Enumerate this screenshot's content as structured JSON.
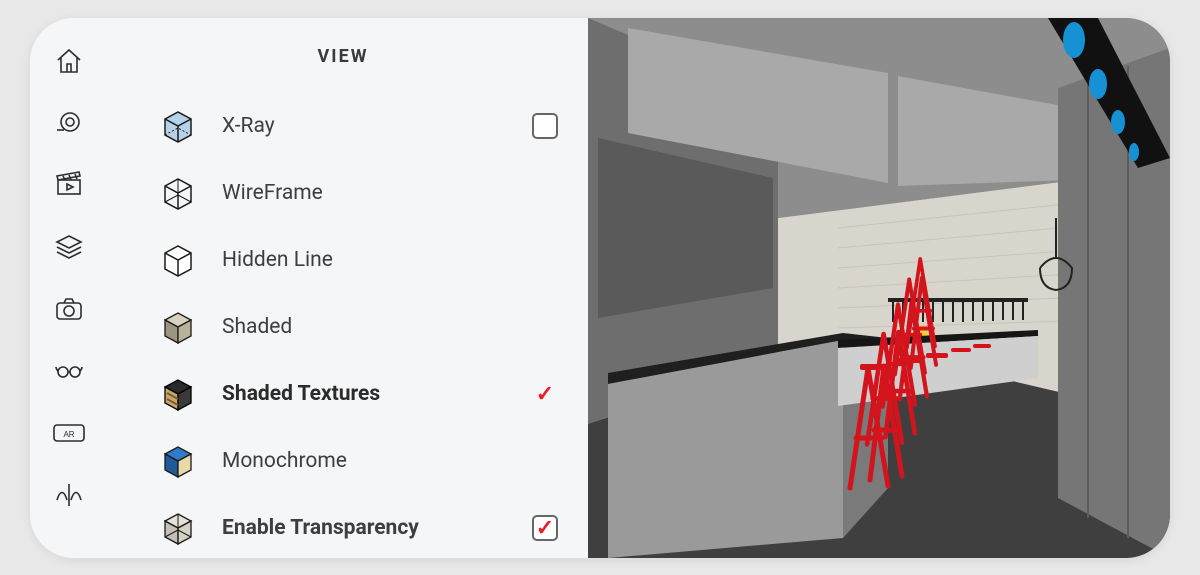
{
  "panel": {
    "title": "VIEW",
    "options": [
      {
        "id": "xray",
        "label": "X-Ray",
        "selected": false,
        "control": "checkbox",
        "checked": false,
        "bold": false
      },
      {
        "id": "wireframe",
        "label": "WireFrame",
        "selected": false,
        "control": "none",
        "checked": false,
        "bold": false
      },
      {
        "id": "hiddenline",
        "label": "Hidden Line",
        "selected": false,
        "control": "none",
        "checked": false,
        "bold": false
      },
      {
        "id": "shaded",
        "label": "Shaded",
        "selected": false,
        "control": "none",
        "checked": false,
        "bold": false
      },
      {
        "id": "shadedtex",
        "label": "Shaded Textures",
        "selected": true,
        "control": "check",
        "checked": true,
        "bold": true
      },
      {
        "id": "monochrome",
        "label": "Monochrome",
        "selected": false,
        "control": "none",
        "checked": false,
        "bold": false
      },
      {
        "id": "transparency",
        "label": "Enable Transparency",
        "selected": false,
        "control": "checkbox",
        "checked": true,
        "bold": true
      }
    ]
  },
  "toolbar": {
    "items": [
      {
        "id": "home",
        "name": "home-icon"
      },
      {
        "id": "measure",
        "name": "tape-measure-icon"
      },
      {
        "id": "scenes",
        "name": "clapperboard-icon"
      },
      {
        "id": "layers",
        "name": "layers-icon"
      },
      {
        "id": "camera",
        "name": "camera-icon"
      },
      {
        "id": "styles",
        "name": "glasses-icon"
      },
      {
        "id": "ar",
        "name": "ar-icon"
      },
      {
        "id": "mirror",
        "name": "mirror-icon"
      }
    ]
  },
  "colors": {
    "accent": "#e1202a"
  }
}
